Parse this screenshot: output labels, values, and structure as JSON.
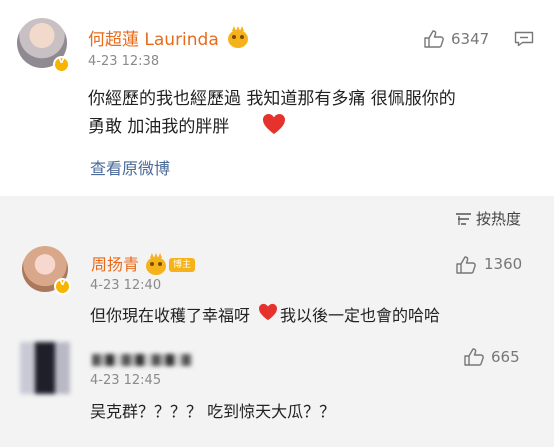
{
  "main_comment": {
    "username": "何超蓮 Laurinda",
    "time": "4-23 12:38",
    "likes": "6347",
    "text_line1": "你經歷的我也經歷過 我知道那有多痛 很佩服你的",
    "text_line2": "勇敢 加油我的胖胖",
    "view_original": "查看原微博"
  },
  "sort": {
    "label": "按热度"
  },
  "replies": [
    {
      "username": "周扬青",
      "badge": "博主",
      "time": "4-23 12:40",
      "likes": "1360",
      "text_before": "但你現在收穫了幸福呀",
      "text_after": "我以後一定也會的哈哈"
    },
    {
      "username": "",
      "time": "4-23 12:45",
      "likes": "665",
      "text": "吴克群？？？？ 吃到惊天大瓜？？"
    }
  ],
  "icons": [
    "like-icon",
    "more-icon",
    "sort-icon",
    "heart-icon",
    "crown-icon",
    "verified-icon"
  ],
  "colors": {
    "username": "#e86b1c",
    "link": "#4a6a99",
    "heart": "#e5322d",
    "badge": "#f5b21b"
  }
}
